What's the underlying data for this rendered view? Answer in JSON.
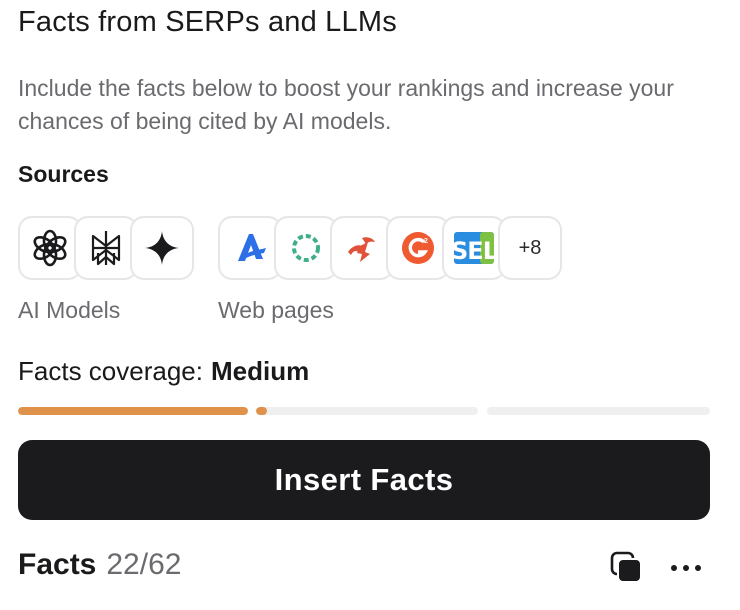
{
  "header": {
    "title": "Facts from SERPs and LLMs",
    "description": "Include the facts below to boost your rankings and increase your chances of being cited by AI models."
  },
  "sources": {
    "heading": "Sources",
    "ai_models": {
      "label": "AI Models",
      "icons": [
        "openai-icon",
        "perplexity-icon",
        "gemini-icon"
      ]
    },
    "web_pages": {
      "label": "Web pages",
      "icons": [
        "a-site-icon",
        "ring-site-icon",
        "red-logo-site-icon",
        "g2-icon",
        "sel-icon"
      ],
      "more_label": "+8"
    }
  },
  "coverage": {
    "label": "Facts coverage:",
    "value": "Medium",
    "segments_filled": [
      1.0,
      0.05,
      0.0
    ],
    "accent_color": "#e0924b",
    "track_color": "#efefef"
  },
  "actions": {
    "insert_label": "Insert Facts"
  },
  "facts": {
    "label": "Facts",
    "count": "22/62"
  },
  "colors": {
    "button_bg": "#1b1b1d",
    "muted_text": "#6b6b6f"
  }
}
